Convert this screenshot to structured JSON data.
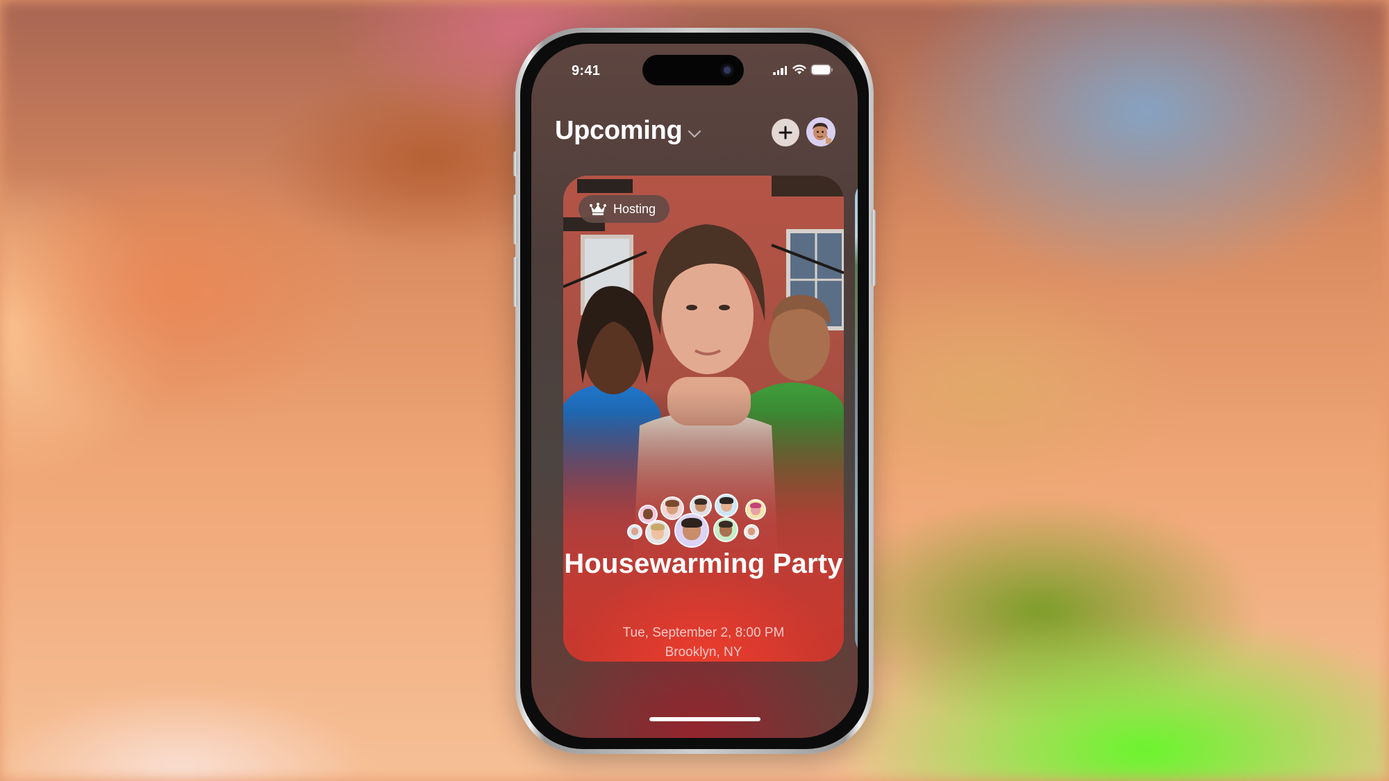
{
  "status_bar": {
    "time": "9:41",
    "icons": [
      "cellular-signal-icon",
      "wifi-icon",
      "battery-icon"
    ]
  },
  "header": {
    "title": "Upcoming",
    "title_icon": "chevron-down-icon",
    "add_button_icon": "plus-icon",
    "profile_avatar": "memoji-avatar"
  },
  "event_card": {
    "badge": {
      "icon": "crown-icon",
      "label": "Hosting"
    },
    "title": "Housewarming Party",
    "date": "Tue, September 2, 8:00 PM",
    "location": "Brooklyn, NY",
    "attendee_count_shown": 11,
    "attendee_colors": [
      "#f3c9e0",
      "#f2d6d8",
      "#e0e0e2",
      "#cfe6f5",
      "#f6e4a8",
      "#dbeaf5",
      "#e3e3e3",
      "#dcd2f5",
      "#c8ecc8",
      "#f0e8e8"
    ]
  },
  "colors": {
    "screen_bg": "#4d3d3a",
    "card_accent": "#df3b2e",
    "text_primary": "#ffffff",
    "pill_bg": "#644b46"
  }
}
